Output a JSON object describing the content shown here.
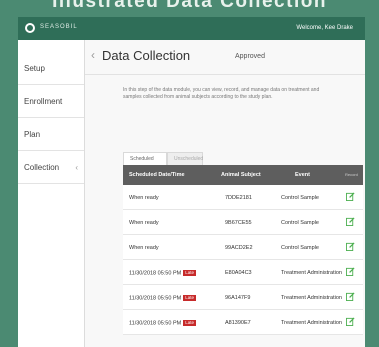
{
  "caption": "Illustrated Data Collection",
  "header": {
    "app_name": "SEASOBIL",
    "welcome": "Welcome, Kee Drake"
  },
  "sidebar": {
    "items": [
      {
        "label": "Setup"
      },
      {
        "label": "Enrollment"
      },
      {
        "label": "Plan"
      },
      {
        "label": "Collection",
        "caret": "‹"
      }
    ]
  },
  "page": {
    "back": "‹",
    "title": "Data Collection",
    "status": "Approved",
    "description": "In this step of the data module, you can view, record, and manage data on treatment and samples collected from animal subjects according to the study plan."
  },
  "tabs": [
    {
      "label": "Scheduled",
      "active": true
    },
    {
      "label": "Unscheduled",
      "active": false
    }
  ],
  "table": {
    "headers": [
      "Scheduled Date/Time",
      "Animal Subject",
      "Event",
      "Record"
    ],
    "rows": [
      {
        "date": "When ready",
        "late": "",
        "subject": "7DDE2181",
        "event": "Control Sample"
      },
      {
        "date": "When ready",
        "late": "",
        "subject": "9B67CE55",
        "event": "Control Sample"
      },
      {
        "date": "When ready",
        "late": "",
        "subject": "99ACD2E2",
        "event": "Control Sample"
      },
      {
        "date": "11/30/2018 05:50 PM",
        "late": "Late",
        "subject": "E80A04C3",
        "event": "Treatment Administration"
      },
      {
        "date": "11/30/2018 05:50 PM",
        "late": "Late",
        "subject": "96A147F9",
        "event": "Treatment Administration"
      },
      {
        "date": "11/30/2018 05:50 PM",
        "late": "Late",
        "subject": "A81390E7",
        "event": "Treatment Administration"
      }
    ]
  },
  "colors": {
    "header": "#2f6e58",
    "late_badge": "#c72b2b",
    "edit_icon": "#4caf50"
  }
}
